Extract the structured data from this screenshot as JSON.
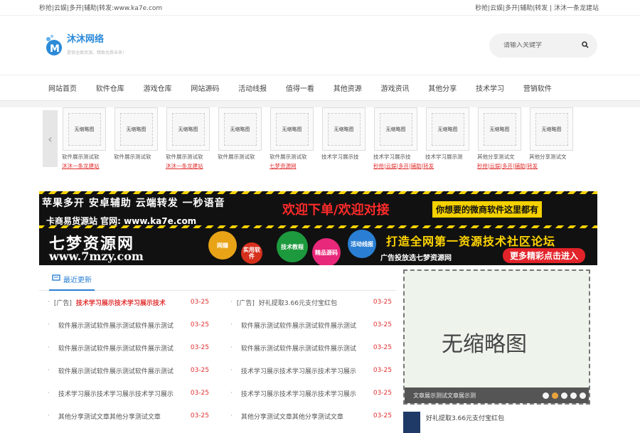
{
  "topbar": {
    "left": "秒抢|云娱|多开|辅助|转发:www.ka7e.com",
    "right": "秒抢|云娱|多开|辅助|转发 | 沐沐一条龙建站"
  },
  "logo": {
    "name": "沐沐网络",
    "slogan": "提供全面资源，精致优质未来！"
  },
  "search": {
    "placeholder": "请输入关键字"
  },
  "nav": [
    "网站首页",
    "软件仓库",
    "游戏仓库",
    "网站源码",
    "活动线报",
    "值得一看",
    "其他资源",
    "游戏资讯",
    "其他分享",
    "技术学习",
    "营销软件"
  ],
  "thumbs": [
    {
      "placeholder": "无缩略图",
      "caption": "软件展示测试软",
      "sub": "沐沐一条龙建站"
    },
    {
      "placeholder": "无缩略图",
      "caption": "软件展示测试软",
      "sub": ""
    },
    {
      "placeholder": "无缩略图",
      "caption": "软件展示测试软",
      "sub": "沐沐一条龙建站"
    },
    {
      "placeholder": "无缩略图",
      "caption": "软件展示测试软",
      "sub": ""
    },
    {
      "placeholder": "无缩略图",
      "caption": "软件展示测试软",
      "sub": "七梦资源网"
    },
    {
      "placeholder": "无缩略图",
      "caption": "技术学习展示技",
      "sub": ""
    },
    {
      "placeholder": "无缩略图",
      "caption": "技术学习展示技",
      "sub": "秒抢|云娱|多开|辅助|转发"
    },
    {
      "placeholder": "无缩略图",
      "caption": "技术学习展示测",
      "sub": ""
    },
    {
      "placeholder": "无缩略图",
      "caption": "其他分享测试文",
      "sub": "秒抢|云娱|多开|辅助|转发"
    },
    {
      "placeholder": "无缩略图",
      "caption": "其他分享测试文",
      "sub": ""
    }
  ],
  "banner1": {
    "line1": "苹果多开 安卓辅助 云端转发 一秒语音",
    "line2": "卡商易货源站 官网: www.ka7e.com",
    "middle": "欢迎下单/欢迎对接",
    "badge": "你想要的微商软件这里都有"
  },
  "banner2": {
    "name": "七梦资源网",
    "url": "www.7mzy.com",
    "bubbles": [
      "网赚",
      "实用软件",
      "技术教程",
      "精品源码",
      "活动线报"
    ],
    "slogan": "打造全网第一资源技术社区论坛",
    "small": "广告投放选七梦资源网",
    "more": "更多精彩点击进入"
  },
  "latest": {
    "tab": "最近更新",
    "items": [
      {
        "prefix": "[广告]",
        "title": "技术学习展示技术学习展示技术",
        "date": "03-25",
        "hot": true
      },
      {
        "prefix": "[广告]",
        "title": "好礼提取3.66元支付宝红包",
        "date": "03-25",
        "hot": false
      },
      {
        "prefix": "",
        "title": "软件展示测试软件展示测试软件展示测试",
        "date": "03-25",
        "hot": false
      },
      {
        "prefix": "",
        "title": "软件展示测试软件展示测试软件展示测试",
        "date": "03-25",
        "hot": false
      },
      {
        "prefix": "",
        "title": "软件展示测试软件展示测试软件展示测试",
        "date": "03-25",
        "hot": false
      },
      {
        "prefix": "",
        "title": "软件展示测试软件展示测试软件展示测试",
        "date": "03-25",
        "hot": false
      },
      {
        "prefix": "",
        "title": "软件展示测试软件展示测试软件展示测试",
        "date": "03-25",
        "hot": false
      },
      {
        "prefix": "",
        "title": "技术学习展示技术学习展示技术学习展示",
        "date": "03-25",
        "hot": false
      },
      {
        "prefix": "",
        "title": "技术学习展示技术学习展示技术学习展示",
        "date": "03-25",
        "hot": false
      },
      {
        "prefix": "",
        "title": "技术学习展示技术学习展示技术学习展示",
        "date": "03-25",
        "hot": false
      },
      {
        "prefix": "",
        "title": "其他分享测试文章其他分享测试文章",
        "date": "03-25",
        "hot": false
      },
      {
        "prefix": "",
        "title": "其他分享测试文章其他分享测试文章",
        "date": "03-25",
        "hot": false
      }
    ]
  },
  "slider": {
    "placeholder": "无缩略图",
    "caption": "文章展示测试文章展示测",
    "active_dot": 1,
    "dot_count": 5
  },
  "side_news": {
    "title": "好礼提取3.66元支付宝红包"
  },
  "colors": {
    "accent": "#2a7fd4",
    "date_red": "#e03030"
  }
}
